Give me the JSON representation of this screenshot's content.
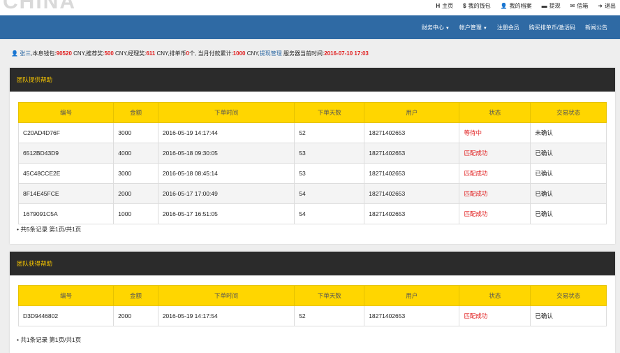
{
  "logo_text": "CHINA",
  "toplinks": [
    {
      "icon": "H",
      "icon_name": "home-icon",
      "label": "主页"
    },
    {
      "icon": "$",
      "icon_name": "dollar-icon",
      "label": "我的钱包"
    },
    {
      "icon": "👤",
      "icon_name": "user-icon",
      "label": "我的档案"
    },
    {
      "icon": "▬",
      "icon_name": "withdraw-icon",
      "label": "提现"
    },
    {
      "icon": "✉",
      "icon_name": "mail-icon",
      "label": "信箱"
    },
    {
      "icon": "➜",
      "icon_name": "logout-icon",
      "label": "退出"
    }
  ],
  "nav": [
    {
      "label": "财务中心",
      "dropdown": true
    },
    {
      "label": "帐户管理",
      "dropdown": true
    },
    {
      "label": "注册会员",
      "dropdown": false
    },
    {
      "label": "购买排单币/激活码",
      "dropdown": false
    },
    {
      "label": "新闻公告",
      "dropdown": false
    }
  ],
  "info": {
    "user": "张三",
    "p1": ",本息钱包:",
    "wallet": "90520",
    "p2": " CNY,推荐奖:",
    "referral": "500",
    "p3": " CNY,经理奖:",
    "manager": "611",
    "p4": " CNY,排单币",
    "queue": "0",
    "p5": "个, 当月付款累计:",
    "monthly": "1000",
    "p6": " CNY,",
    "withdraw_link": "提现管理",
    "p7": "  服务器当前时间:",
    "server_time": "2016-07-10 17:03"
  },
  "columns": [
    "编号",
    "金额",
    "下单时间",
    "下单天数",
    "用户",
    "状态",
    "交易状态"
  ],
  "provide_panel": {
    "title": "团队提供帮助",
    "rows": [
      [
        "C20AD4D76F",
        "3000",
        "2016-05-19 14:17:44",
        "52",
        "18271402653",
        "等待中",
        "未确认"
      ],
      [
        "6512BD43D9",
        "4000",
        "2016-05-18 09:30:05",
        "53",
        "18271402653",
        "匹配成功",
        "已确认"
      ],
      [
        "45C48CCE2E",
        "3000",
        "2016-05-18 08:45:14",
        "53",
        "18271402653",
        "匹配成功",
        "已确认"
      ],
      [
        "8F14E45FCE",
        "2000",
        "2016-05-17 17:00:49",
        "54",
        "18271402653",
        "匹配成功",
        "已确认"
      ],
      [
        "1679091C5A",
        "1000",
        "2016-05-17 16:51:05",
        "54",
        "18271402653",
        "匹配成功",
        "已确认"
      ]
    ],
    "summary": "共5条记录 第1页/共1页"
  },
  "receive_panel": {
    "title": "团队获得帮助",
    "rows": [
      [
        "D3D9446802",
        "2000",
        "2016-05-19 14:17:54",
        "52",
        "18271402653",
        "匹配成功",
        "已确认"
      ]
    ],
    "summary": "共1条记录 第1页/共1页"
  },
  "colors": {
    "navbar": "#2f6aa4",
    "header_yellow": "#ffd600",
    "panel_dark": "#2b2b2b",
    "status_red": "#e01d1d"
  }
}
